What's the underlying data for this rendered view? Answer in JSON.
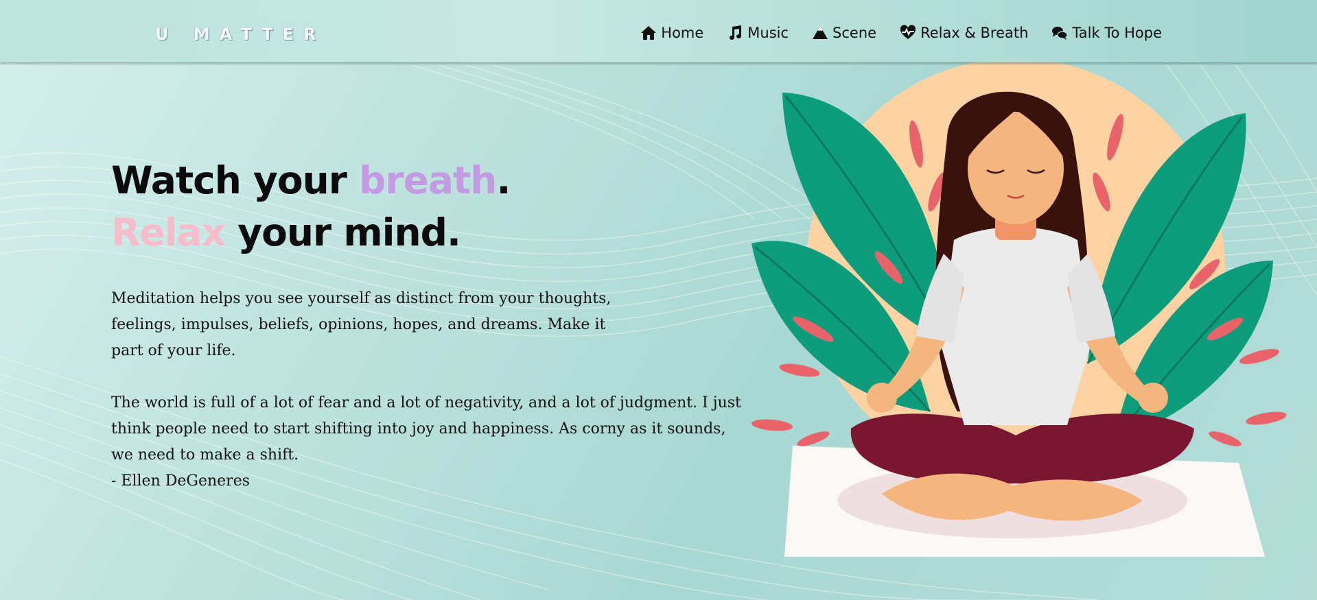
{
  "header": {
    "logo_text": "U MATTER",
    "nav": [
      {
        "label": "Home",
        "icon": "home-icon"
      },
      {
        "label": "Music",
        "icon": "music-icon"
      },
      {
        "label": "Scene",
        "icon": "mountain-icon"
      },
      {
        "label": "Relax & Breath",
        "icon": "heartbeat-icon"
      },
      {
        "label": "Talk To Hope",
        "icon": "chat-icon"
      }
    ]
  },
  "hero": {
    "line1_a": "Watch your ",
    "line1_b": "breath",
    "line1_c": ".",
    "line2_a": "Relax",
    "line2_b": " your mind.",
    "paragraph1": "Meditation helps you see yourself as distinct from your thoughts, feelings, impulses, beliefs, opinions, hopes, and dreams. Make it part of your life.",
    "paragraph2": "The world is full of a lot of fear and a lot of negativity, and a lot of judgment. I just think people need to start shifting into joy and happiness. As corny as it sounds, we need to make a shift.",
    "author": "- Ellen DeGeneres"
  },
  "colors": {
    "breath": "#c39be3",
    "relax": "#f6bccb",
    "background": "#b3dcd7"
  }
}
